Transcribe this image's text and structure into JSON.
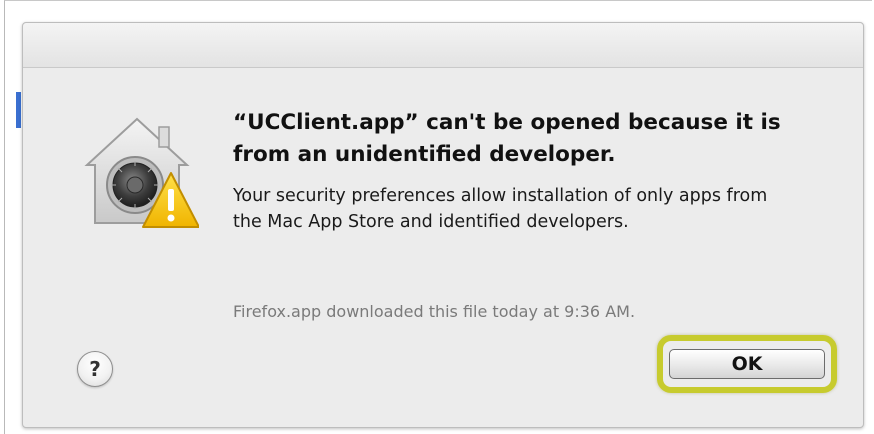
{
  "dialog": {
    "title": "“UCClient.app” can't be opened because it is from an unidentified developer.",
    "message": "Your security preferences allow installation of only apps from the Mac App Store and identified developers.",
    "source_note": "Firefox.app downloaded this file today at 9:36 AM.",
    "help_label": "?",
    "ok_label": "OK",
    "icon": "gatekeeper-warning-icon"
  },
  "colors": {
    "highlight_ring": "#c7cb2e",
    "dialog_background": "#ececec",
    "side_accent": "#3a6fd0",
    "warning_triangle": "#f5c400"
  }
}
